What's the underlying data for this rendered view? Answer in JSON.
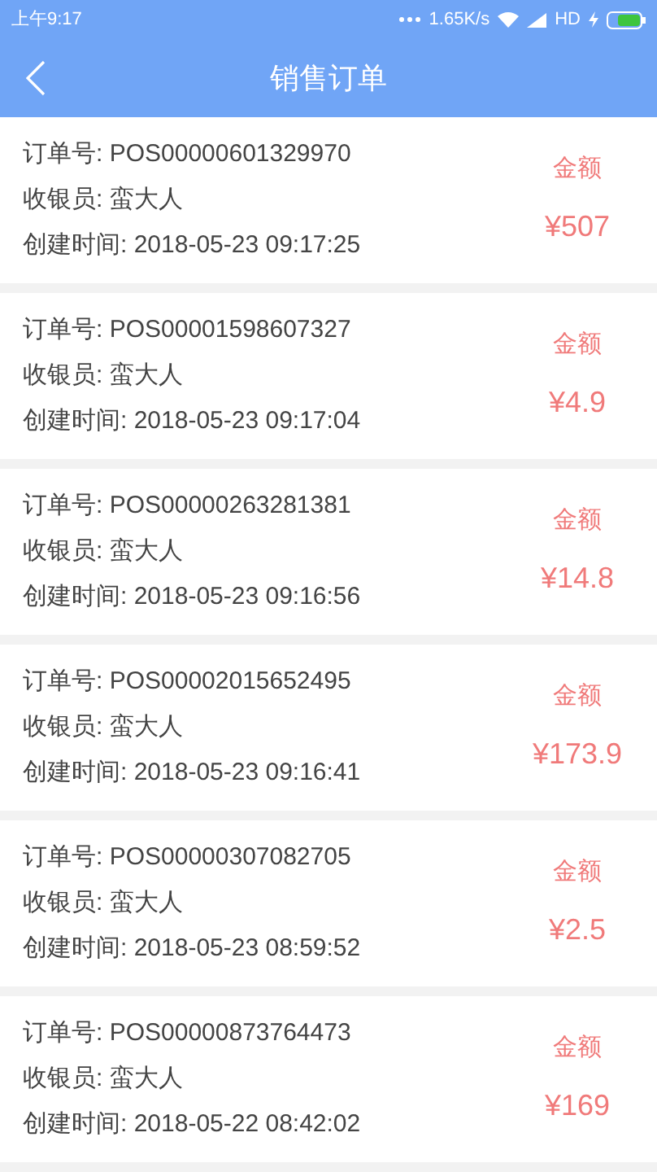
{
  "status_bar": {
    "time": "上午9:17",
    "speed": "1.65K/s",
    "network": "HD"
  },
  "header": {
    "title": "销售订单"
  },
  "orders": [
    {
      "order_no": "订单号: POS00000601329970",
      "cashier": "收银员: 蛮大人",
      "created": "创建时间: 2018-05-23 09:17:25",
      "amount_label": "金额",
      "amount": "¥507"
    },
    {
      "order_no": "订单号: POS00001598607327",
      "cashier": "收银员: 蛮大人",
      "created": "创建时间: 2018-05-23 09:17:04",
      "amount_label": "金额",
      "amount": "¥4.9"
    },
    {
      "order_no": "订单号: POS00000263281381",
      "cashier": "收银员: 蛮大人",
      "created": "创建时间: 2018-05-23 09:16:56",
      "amount_label": "金额",
      "amount": "¥14.8"
    },
    {
      "order_no": "订单号: POS00002015652495",
      "cashier": "收银员: 蛮大人",
      "created": "创建时间: 2018-05-23 09:16:41",
      "amount_label": "金额",
      "amount": "¥173.9"
    },
    {
      "order_no": "订单号: POS00000307082705",
      "cashier": "收银员: 蛮大人",
      "created": "创建时间: 2018-05-23 08:59:52",
      "amount_label": "金额",
      "amount": "¥2.5"
    },
    {
      "order_no": "订单号: POS00000873764473",
      "cashier": "收银员: 蛮大人",
      "created": "创建时间: 2018-05-22 08:42:02",
      "amount_label": "金额",
      "amount": "¥169"
    }
  ]
}
